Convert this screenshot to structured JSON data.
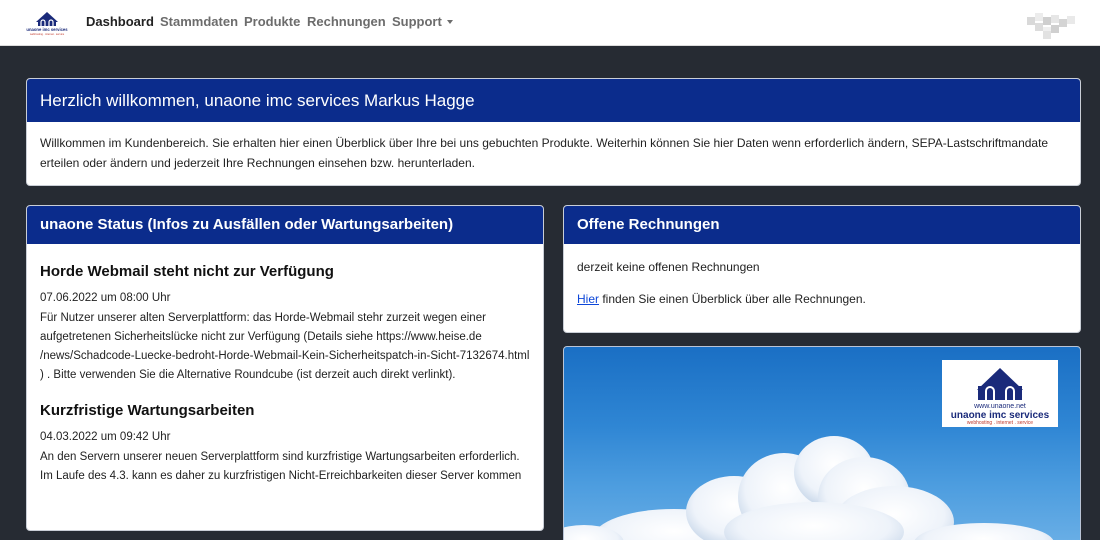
{
  "nav": {
    "items": [
      {
        "label": "Dashboard"
      },
      {
        "label": "Stammdaten"
      },
      {
        "label": "Produkte"
      },
      {
        "label": "Rechnungen"
      },
      {
        "label": "Support"
      }
    ]
  },
  "welcome": {
    "title": "Herzlich willkommen, unaone imc services Markus Hagge",
    "text": "Willkommen im Kundenbereich. Sie erhalten hier einen Überblick über Ihre bei uns gebuchten Produkte. Weiterhin können Sie hier Daten wenn erforderlich ändern, SEPA-Lastschriftmandate erteilen oder ändern und jederzeit Ihre Rechnungen einsehen bzw. herunterladen."
  },
  "status": {
    "title": "unaone Status (Infos zu Ausfällen oder Wartungsarbeiten)",
    "news": [
      {
        "headline": "Horde Webmail steht nicht zur Verfügung",
        "date": "07.06.2022 um 08:00 Uhr",
        "text": "Für Nutzer unserer alten Serverplattform: das Horde-Webmail stehr zurzeit wegen einer aufgetretenen Sicherheitslücke nicht zur Verfügung (Details siehe https://www.heise.de /news/Schadcode-Luecke-bedroht-Horde-Webmail-Kein-Sicherheitspatch-in-Sicht-7132674.html ) . Bitte verwenden Sie die Alternative Roundcube (ist derzeit auch direkt verlinkt)."
      },
      {
        "headline": "Kurzfristige Wartungsarbeiten",
        "date": "04.03.2022 um 09:42 Uhr",
        "text": "An den Servern unserer neuen Serverplattform sind kurzfristige Wartungsarbeiten erforderlich. Im Laufe des 4.3. kann es daher zu kurzfristigen Nicht-Erreichbarkeiten dieser Server kommen"
      }
    ]
  },
  "invoices": {
    "title": "Offene Rechnungen",
    "empty_text": "derzeit keine offenen Rechnungen",
    "link_label": "Hier",
    "link_suffix": " finden Sie einen Überblick über alle Rechnungen."
  },
  "brand_logo": {
    "url_text": "www.unaone.net",
    "name": "unaone imc services",
    "tagline": "webhosting . internet . service"
  },
  "colors": {
    "header_blue": "#0b2c8c",
    "page_background": "#262b33",
    "link": "#0d47d9"
  }
}
